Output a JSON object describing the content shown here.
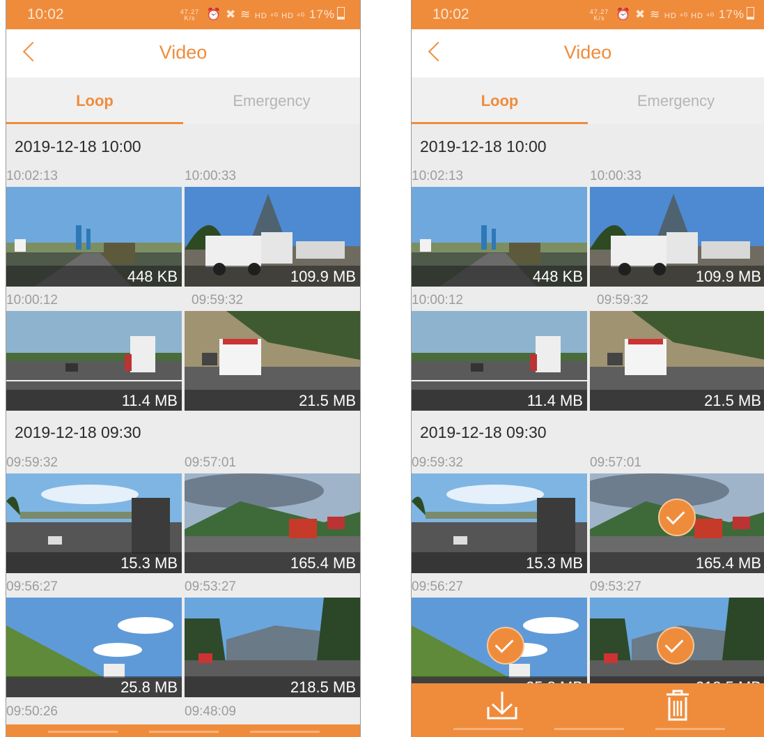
{
  "status": {
    "time": "10:02",
    "speed_top": "47.27",
    "speed_unit": "K/s",
    "battery": "17%",
    "network": "HD ⁴ᴳ HD ⁴ᴳ"
  },
  "header": {
    "title": "Video"
  },
  "tabs": [
    {
      "label": "Loop",
      "active": true
    },
    {
      "label": "Emergency",
      "active": false
    }
  ],
  "colors": {
    "accent": "#ef8c3c",
    "background": "#ececec"
  },
  "groups": [
    {
      "date": "2019-12-18 10:00",
      "videos": [
        {
          "time": "10:02:13",
          "size": "448 KB",
          "scene": "highway-bridge-truck"
        },
        {
          "time": "10:00:33",
          "size": "109.9 MB",
          "scene": "white-trucks-trees"
        },
        {
          "time": "10:00:12",
          "size": "11.4 MB",
          "scene": "highway-box-truck"
        },
        {
          "time": "09:59:32",
          "size": "21.5 MB",
          "scene": "police-suv-hill"
        }
      ]
    },
    {
      "date": "2019-12-18 09:30",
      "videos": [
        {
          "time": "09:59:32",
          "size": "15.3 MB",
          "scene": "overpass-truck"
        },
        {
          "time": "09:57:01",
          "size": "165.4 MB",
          "scene": "mountain-red-jeep",
          "selected_right": true
        },
        {
          "time": "09:56:27",
          "size": "25.8 MB",
          "scene": "grass-hill-rv",
          "selected_right": true
        },
        {
          "time": "09:53:27",
          "size": "218.5 MB",
          "scene": "mountain-road-red-car",
          "selected_right": true
        }
      ]
    }
  ],
  "more_times": [
    "09:50:26",
    "09:48:09"
  ],
  "actions": {
    "download_icon": "download-icon",
    "delete_icon": "trash-icon"
  }
}
